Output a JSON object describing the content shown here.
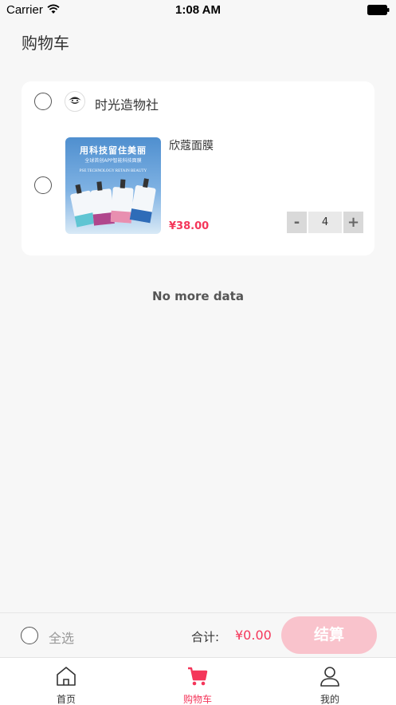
{
  "status_bar": {
    "carrier": "Carrier",
    "time": "1:08 AM"
  },
  "page": {
    "title": "购物车"
  },
  "cart": {
    "shop_name": "时光造物社",
    "item": {
      "name": "欣蔻面膜",
      "price": "¥38.00",
      "quantity": "4",
      "minus_label": "-",
      "plus_label": "+",
      "image_text": {
        "headline": "用科技留住美丽",
        "subline": "全球首创APP智能科技面膜",
        "english": "PSE TECHNOLOGY RETAIN BEAUTY"
      }
    }
  },
  "list_footer": "No more data",
  "checkout": {
    "select_all": "全选",
    "total_label": "合计:",
    "total_value": "¥0.00",
    "button": "结算"
  },
  "tabs": [
    {
      "label": "首页",
      "icon": "home-icon"
    },
    {
      "label": "购物车",
      "icon": "cart-icon",
      "active": true
    },
    {
      "label": "我的",
      "icon": "user-icon"
    }
  ],
  "colors": {
    "accent": "#f4365a",
    "checkout_button": "#f9c3cc",
    "background": "#f7f7f7"
  }
}
